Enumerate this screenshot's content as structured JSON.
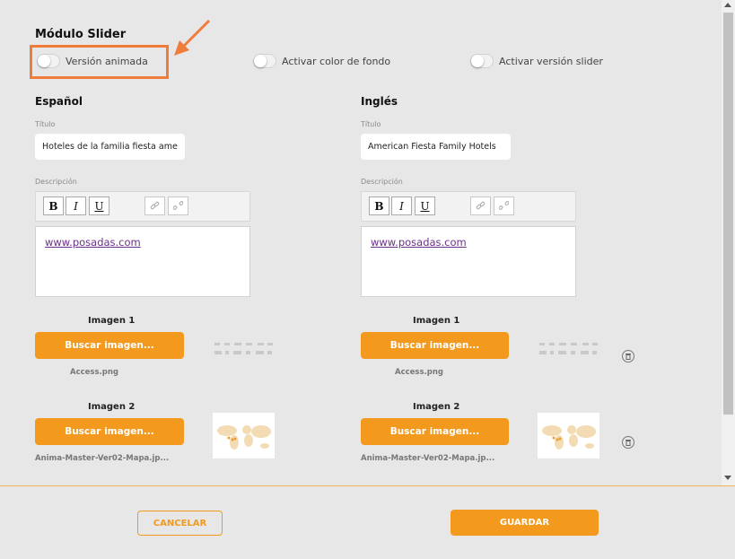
{
  "module": {
    "title": "Módulo Slider"
  },
  "toggles": [
    {
      "label": "Versión animada",
      "on": false
    },
    {
      "label": "Activar color de fondo",
      "on": false
    },
    {
      "label": "Activar versión slider",
      "on": false
    }
  ],
  "spanish": {
    "heading": "Español",
    "title_label": "Título",
    "title_value": "Hoteles de la familia fiesta ame",
    "desc_label": "Descripción",
    "desc_link": "www.posadas.com",
    "image1_label": "Imagen 1",
    "image1_button": "Buscar imagen...",
    "image1_file": "Access.png",
    "image2_label": "Imagen 2",
    "image2_button": "Buscar imagen...",
    "image2_file": "Anima-Master-Ver02-Mapa.jp..."
  },
  "english": {
    "heading": "Inglés",
    "title_label": "Título",
    "title_value": "American Fiesta Family Hotels",
    "desc_label": "Descripción",
    "desc_link": "www.posadas.com",
    "image1_label": "Imagen 1",
    "image1_button": "Buscar imagen...",
    "image1_file": "Access.png",
    "image2_label": "Imagen 2",
    "image2_button": "Buscar imagen...",
    "image2_file": "Anima-Master-Ver02-Mapa.jp..."
  },
  "toolbar": {
    "bold": "B",
    "italic": "I",
    "underline": "U"
  },
  "footer": {
    "cancel": "CANCELAR",
    "save": "GUARDAR"
  },
  "colors": {
    "accent": "#f39a1e",
    "highlight": "#f07c3c",
    "background": "#e7e7e7"
  },
  "icons": [
    "link-icon",
    "unlink-icon",
    "trash-icon",
    "annotation-arrow-icon"
  ]
}
